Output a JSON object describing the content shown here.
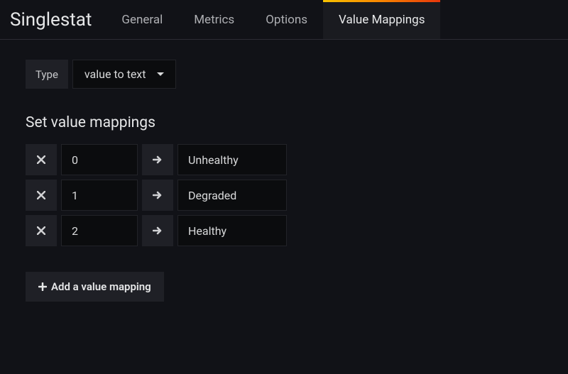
{
  "panelTitle": "Singlestat",
  "tabs": {
    "general": "General",
    "metrics": "Metrics",
    "options": "Options",
    "valueMappings": "Value Mappings"
  },
  "typeRow": {
    "label": "Type",
    "selected": "value to text"
  },
  "sectionTitle": "Set value mappings",
  "mappings": [
    {
      "value": "0",
      "text": "Unhealthy"
    },
    {
      "value": "1",
      "text": "Degraded"
    },
    {
      "value": "2",
      "text": "Healthy"
    }
  ],
  "addButton": "Add a value mapping"
}
